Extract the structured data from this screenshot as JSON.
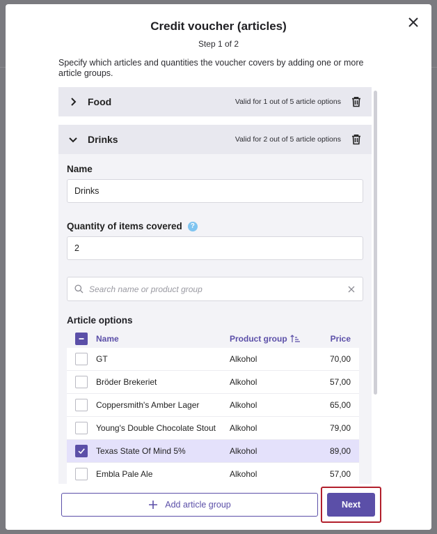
{
  "modal": {
    "title": "Credit voucher (articles)",
    "step": "Step 1 of 2",
    "description": "Specify which articles and quantities the voucher covers by adding one or more article groups."
  },
  "groups": [
    {
      "name": "Food",
      "valid_text": "Valid for 1 out of 5 article options",
      "expanded": false
    },
    {
      "name": "Drinks",
      "valid_text": "Valid for 2 out of 5 article options",
      "expanded": true
    }
  ],
  "form": {
    "name_label": "Name",
    "name_value": "Drinks",
    "quantity_label": "Quantity of items covered",
    "quantity_value": "2",
    "search_placeholder": "Search name or product group",
    "articles_label": "Article options"
  },
  "table": {
    "headers": {
      "name": "Name",
      "group": "Product group",
      "price": "Price"
    },
    "rows": [
      {
        "name": "GT",
        "group": "Alkohol",
        "price": "70,00",
        "checked": false
      },
      {
        "name": "Bröder Brekeriet",
        "group": "Alkohol",
        "price": "57,00",
        "checked": false
      },
      {
        "name": "Coppersmith's Amber Lager",
        "group": "Alkohol",
        "price": "65,00",
        "checked": false
      },
      {
        "name": "Young's Double Chocolate Stout",
        "group": "Alkohol",
        "price": "79,00",
        "checked": false
      },
      {
        "name": "Texas State Of Mind 5%",
        "group": "Alkohol",
        "price": "89,00",
        "checked": true
      },
      {
        "name": "Embla Pale Ale",
        "group": "Alkohol",
        "price": "57,00",
        "checked": false
      }
    ]
  },
  "footer": {
    "add_group_label": "Add article group",
    "next_label": "Next"
  },
  "colors": {
    "accent": "#5b4fa8",
    "selected_row": "#e4e1fb",
    "highlight": "#b21f2c",
    "help": "#7fc4f0"
  },
  "icons": [
    "close-icon",
    "chevron-right-icon",
    "chevron-down-icon",
    "trash-icon",
    "help-icon",
    "search-icon",
    "clear-icon",
    "sort-icon",
    "checkbox-icon",
    "plus-icon"
  ]
}
